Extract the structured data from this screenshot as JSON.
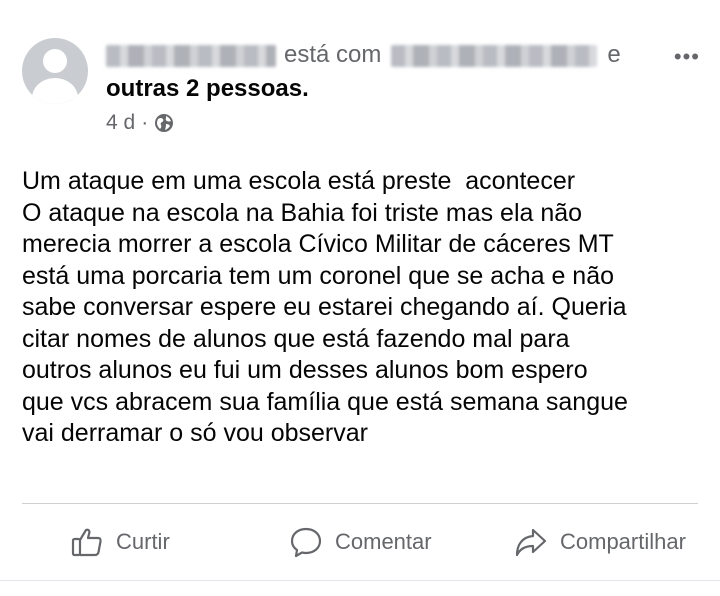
{
  "post": {
    "connector": "está com",
    "and_text": "e",
    "others": "outras 2 pessoas",
    "time": "4 d",
    "more_label": "•••",
    "text": "Um ataque em uma escola está preste  acontecer\nO ataque na escola na Bahia foi triste mas ela não\nmerecia morrer a escola Cívico Militar de cáceres MT\nestá uma porcaria tem um coronel que se acha e não\nsabe conversar espere eu estarei chegando aí. Queria\ncitar nomes de alunos que está fazendo mal para\noutros alunos eu fui um desses alunos bom espero\nque vcs abracem sua família que está semana sangue\nvai derramar o só vou observar"
  },
  "actions": {
    "like": "Curtir",
    "comment": "Comentar",
    "share": "Compartilhar"
  },
  "icons": {
    "avatar": "default-avatar-icon",
    "privacy": "globe-icon",
    "more": "more-options-icon",
    "like": "thumbs-up-icon",
    "comment": "comment-icon",
    "share": "share-icon"
  },
  "colors": {
    "text": "#050505",
    "secondary": "#65676b",
    "divider": "#ced0d4"
  }
}
